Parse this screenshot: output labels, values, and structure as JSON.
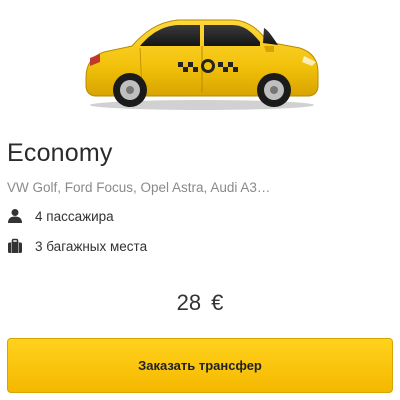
{
  "vehicle": {
    "image_icon": "taxi-car-image",
    "class_name": "Economy",
    "models": "VW Golf, Ford Focus, Opel Astra, Audi A3…",
    "features": [
      {
        "icon": "person-icon",
        "label": "4 пассажира"
      },
      {
        "icon": "luggage-icon",
        "label": "3 багажных места"
      }
    ],
    "price": "28 €",
    "order_button_label": "Заказать трансфер"
  },
  "colors": {
    "car_body": "#f2c20b",
    "button_bg": "#fcc610",
    "title_text": "#2b2b2b",
    "muted_text": "#8a8a8a"
  }
}
